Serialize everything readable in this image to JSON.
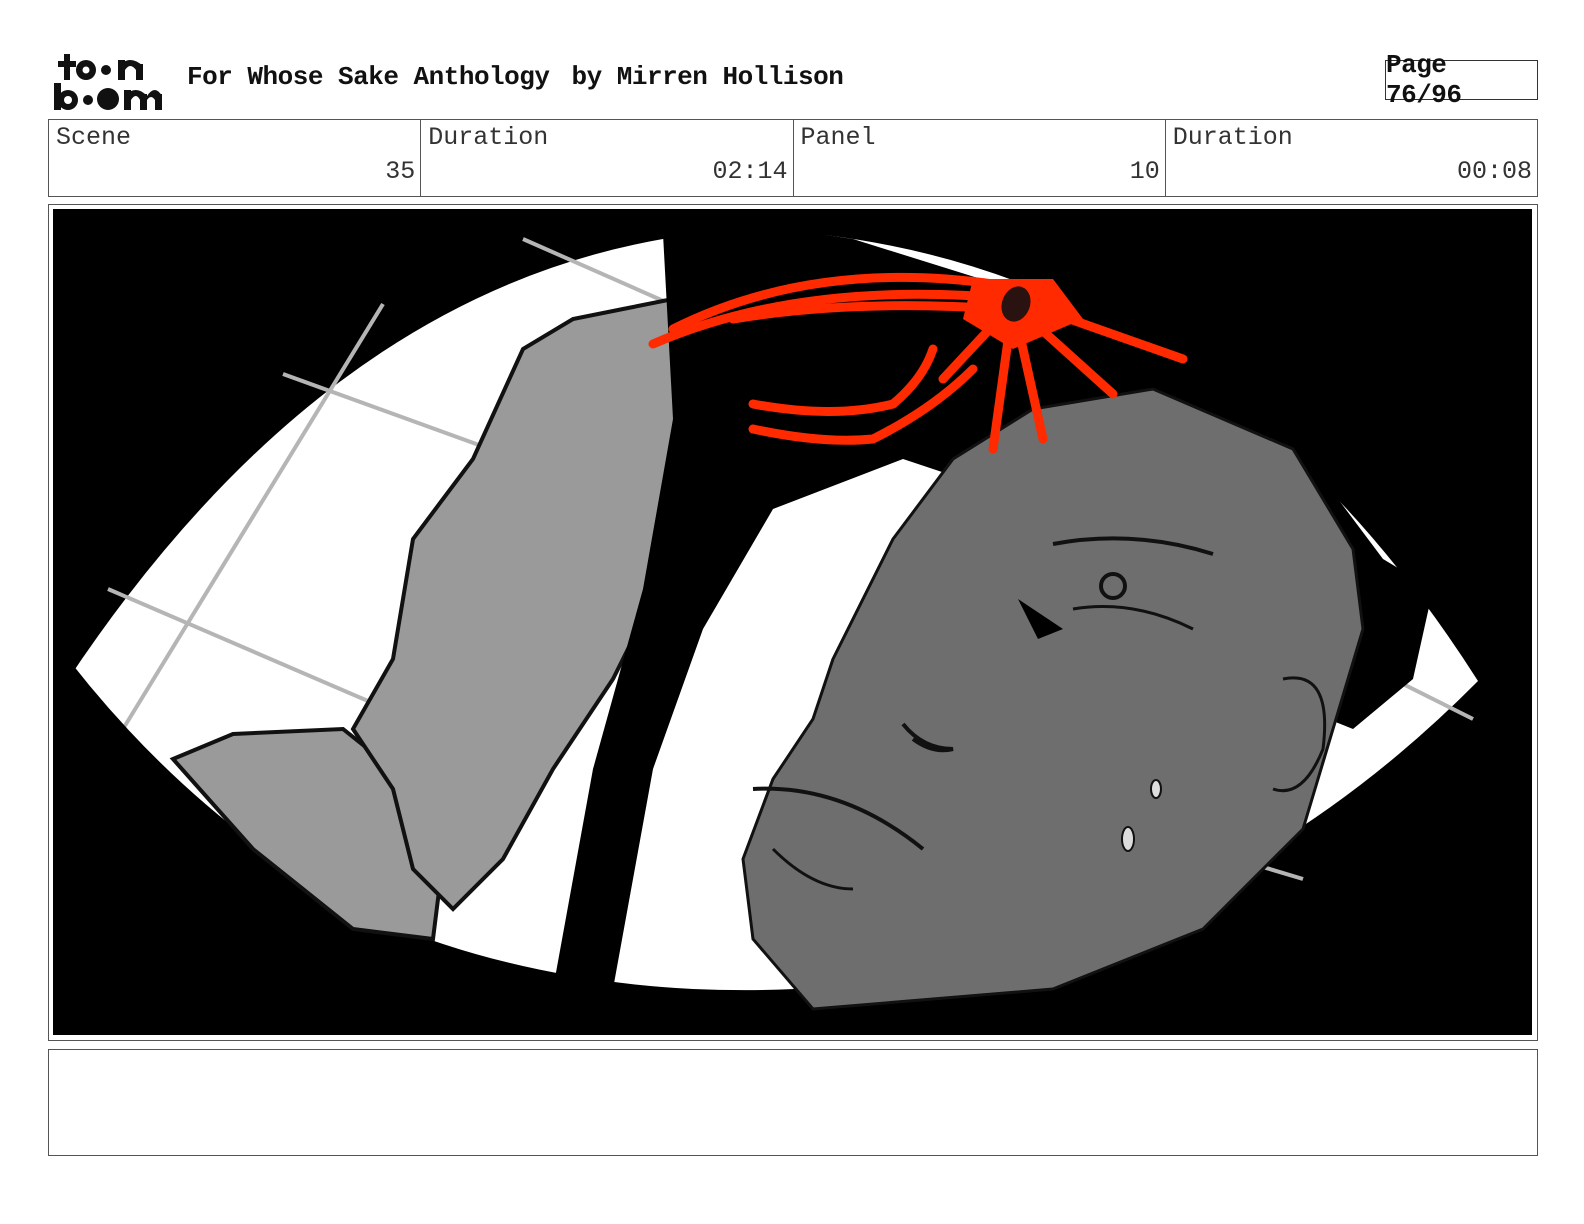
{
  "header": {
    "logo_top": "to•n",
    "logo_bottom": "b•om",
    "project_title": "For Whose Sake Anthology",
    "author": "by Mirren Hollison",
    "page_label": "Page 76/96"
  },
  "info": {
    "scene_label": "Scene",
    "scene_value": "35",
    "scene_duration_label": "Duration",
    "scene_duration_value": "02:14",
    "panel_label": "Panel",
    "panel_value": "10",
    "panel_duration_label": "Duration",
    "panel_duration_value": "00:08"
  },
  "notes": {
    "text": ""
  },
  "colors": {
    "accent_red": "#ff2a00",
    "skin_gray": "#6e6e6e",
    "hand_gray": "#9a9a9a",
    "background": "#000000"
  }
}
